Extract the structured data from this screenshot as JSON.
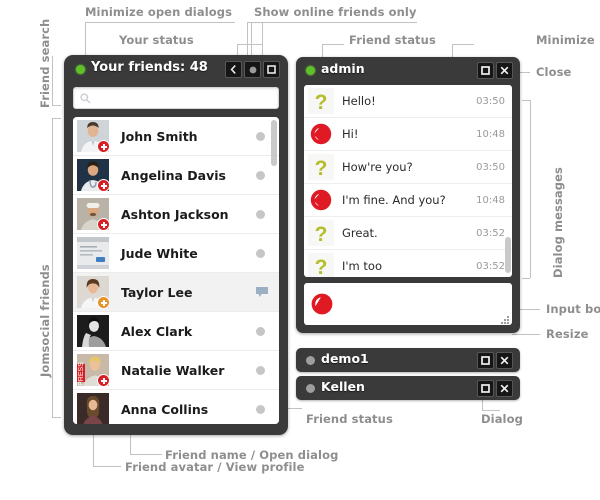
{
  "friends_panel": {
    "status_icon": "online-dot",
    "title": "Your friends: 48",
    "count": 48,
    "buttons": [
      {
        "name": "minimize-open-dialogs",
        "icon": "chevron-left-icon",
        "glyph": "‹"
      },
      {
        "name": "show-online-friends-only",
        "icon": "circle-icon",
        "glyph": "●"
      },
      {
        "name": "minimize-panel",
        "icon": "square-icon",
        "glyph": "□"
      }
    ],
    "search": {
      "placeholder": "",
      "value": "",
      "icon": "search-icon"
    },
    "friends": [
      {
        "name": "John Smith",
        "status": "offline",
        "badge": "red-plus",
        "has_unread": false
      },
      {
        "name": "Angelina Davis",
        "status": "offline",
        "badge": "red-plus",
        "has_unread": false
      },
      {
        "name": "Ashton Jackson",
        "status": "offline",
        "badge": "red-plus",
        "has_unread": false
      },
      {
        "name": "Jude White",
        "status": "offline",
        "badge": "none",
        "has_unread": false
      },
      {
        "name": "Taylor Lee",
        "status": "offline",
        "badge": "orange-plus",
        "has_unread": true
      },
      {
        "name": "Alex Clark",
        "status": "offline",
        "badge": "none",
        "has_unread": false
      },
      {
        "name": "Natalie Walker",
        "status": "offline",
        "badge": "red-plus",
        "has_unread": false
      },
      {
        "name": "Anna Collins",
        "status": "offline",
        "badge": "none",
        "has_unread": false
      }
    ]
  },
  "chat_dialog": {
    "status_icon": "online-dot",
    "title": "admin",
    "buttons": [
      {
        "name": "minimize-dialog",
        "icon": "square-icon",
        "glyph": "□"
      },
      {
        "name": "close-dialog",
        "icon": "close-icon",
        "glyph": "✕"
      }
    ],
    "messages": [
      {
        "avatar": "question-mark-avatar",
        "text": "Hello!",
        "time": "03:50"
      },
      {
        "avatar": "red-logo-avatar",
        "text": "Hi!",
        "time": "10:48"
      },
      {
        "avatar": "question-mark-avatar",
        "text": "How're you?",
        "time": "03:50"
      },
      {
        "avatar": "red-logo-avatar",
        "text": "I'm fine. And you?",
        "time": "10:48"
      },
      {
        "avatar": "question-mark-avatar",
        "text": "Great.",
        "time": "03:52"
      },
      {
        "avatar": "question-mark-avatar",
        "text": "I'm too",
        "time": "03:52"
      }
    ],
    "input": {
      "avatar": "red-logo-avatar",
      "value": "",
      "placeholder": ""
    }
  },
  "collapsed_dialogs": [
    {
      "title": "demo1",
      "status": "offline",
      "buttons": [
        "square-icon",
        "close-icon"
      ]
    },
    {
      "title": "Kellen",
      "status": "offline",
      "buttons": [
        "square-icon",
        "close-icon"
      ]
    }
  ],
  "annotations": {
    "friend_search": "Friend search",
    "jomsocial_friends": "Jomsocial friends",
    "minimize_open_dialogs": "Minimize open dialogs",
    "your_status": "Your status",
    "show_online_friends_only": "Show online friends only",
    "friend_status_top": "Friend status",
    "minimize": "Minimize",
    "close": "Close",
    "dialog_messages": "Dialog messages",
    "input_box": "Input box",
    "resize": "Resize",
    "friend_status_bottom": "Friend status",
    "dialog": "Dialog",
    "friend_name_open_dialog": "Friend name / Open dialog",
    "friend_avatar_view_profile": "Friend avatar / View profile"
  },
  "colors": {
    "panel_bg": "#3a3a3a",
    "online_green": "#5ec227",
    "offline_gray": "#c6c6c6",
    "badge_red": "#d81f26",
    "badge_orange": "#e8922a",
    "annotation_gray": "#8e8e8e"
  }
}
